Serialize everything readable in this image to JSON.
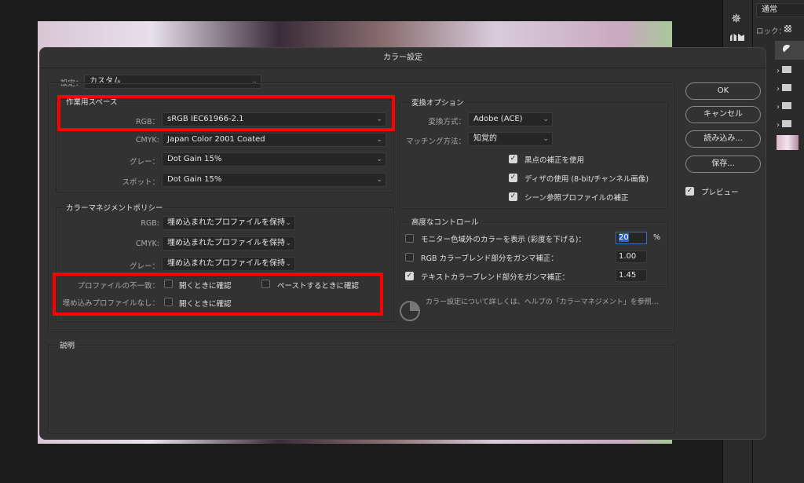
{
  "app": {
    "blend_mode": "通常",
    "lock_label": "ロック："
  },
  "dialog": {
    "title": "カラー設定",
    "settings": {
      "label": "設定：",
      "value": "カスタム"
    },
    "working_spaces": {
      "title": "作業用スペース",
      "rows": [
        {
          "label": "RGB：",
          "value": "sRGB IEC61966-2.1"
        },
        {
          "label": "CMYK:",
          "value": "Japan Color 2001 Coated"
        },
        {
          "label": "グレー：",
          "value": "Dot Gain 15%"
        },
        {
          "label": "スポット：",
          "value": "Dot Gain 15%"
        }
      ]
    },
    "policies": {
      "title": "カラーマネジメントポリシー",
      "rows": [
        {
          "label": "RGB:",
          "value": "埋め込まれたプロファイルを保持"
        },
        {
          "label": "CMYK:",
          "value": "埋め込まれたプロファイルを保持"
        },
        {
          "label": "グレー：",
          "value": "埋め込まれたプロファイルを保持"
        }
      ],
      "mismatch_label": "プロファイルの不一致：",
      "mismatch_open": {
        "label": "開くときに確認",
        "checked": false
      },
      "mismatch_paste": {
        "label": "ペーストするときに確認",
        "checked": false
      },
      "missing_label": "埋め込みプロファイルなし：",
      "missing_open": {
        "label": "開くときに確認",
        "checked": false
      }
    },
    "conversion": {
      "title": "変換オプション",
      "engine_label": "変換方式：",
      "engine": "Adobe (ACE)",
      "intent_label": "マッチング方法：",
      "intent": "知覚的",
      "checks": [
        {
          "label": "黒点の補正を使用",
          "checked": true
        },
        {
          "label": "ディザの使用 (8-bit/チャンネル画像)",
          "checked": true
        },
        {
          "label": "シーン参照プロファイルの補正",
          "checked": true
        }
      ]
    },
    "advanced": {
      "title": "高度なコントロール",
      "rows": [
        {
          "label": "モニター色域外のカラーを表示 (彩度を下げる)：",
          "value": "20",
          "unit": "%",
          "checked": false
        },
        {
          "label": "RGB カラーブレンド部分をガンマ補正：",
          "value": "1.00",
          "checked": false
        },
        {
          "label": "テキストカラーブレンド部分をガンマ補正：",
          "value": "1.45",
          "checked": true
        }
      ]
    },
    "help_text": "カラー設定について詳しくは、ヘルプの「カラーマネジメント」を参照…",
    "description": {
      "title": "説明"
    },
    "buttons": {
      "ok": "OK",
      "cancel": "キャンセル",
      "load": "読み込み...",
      "save": "保存..."
    },
    "preview": {
      "label": "プレビュー",
      "checked": true
    },
    "highlight_color": "#ff0000"
  }
}
